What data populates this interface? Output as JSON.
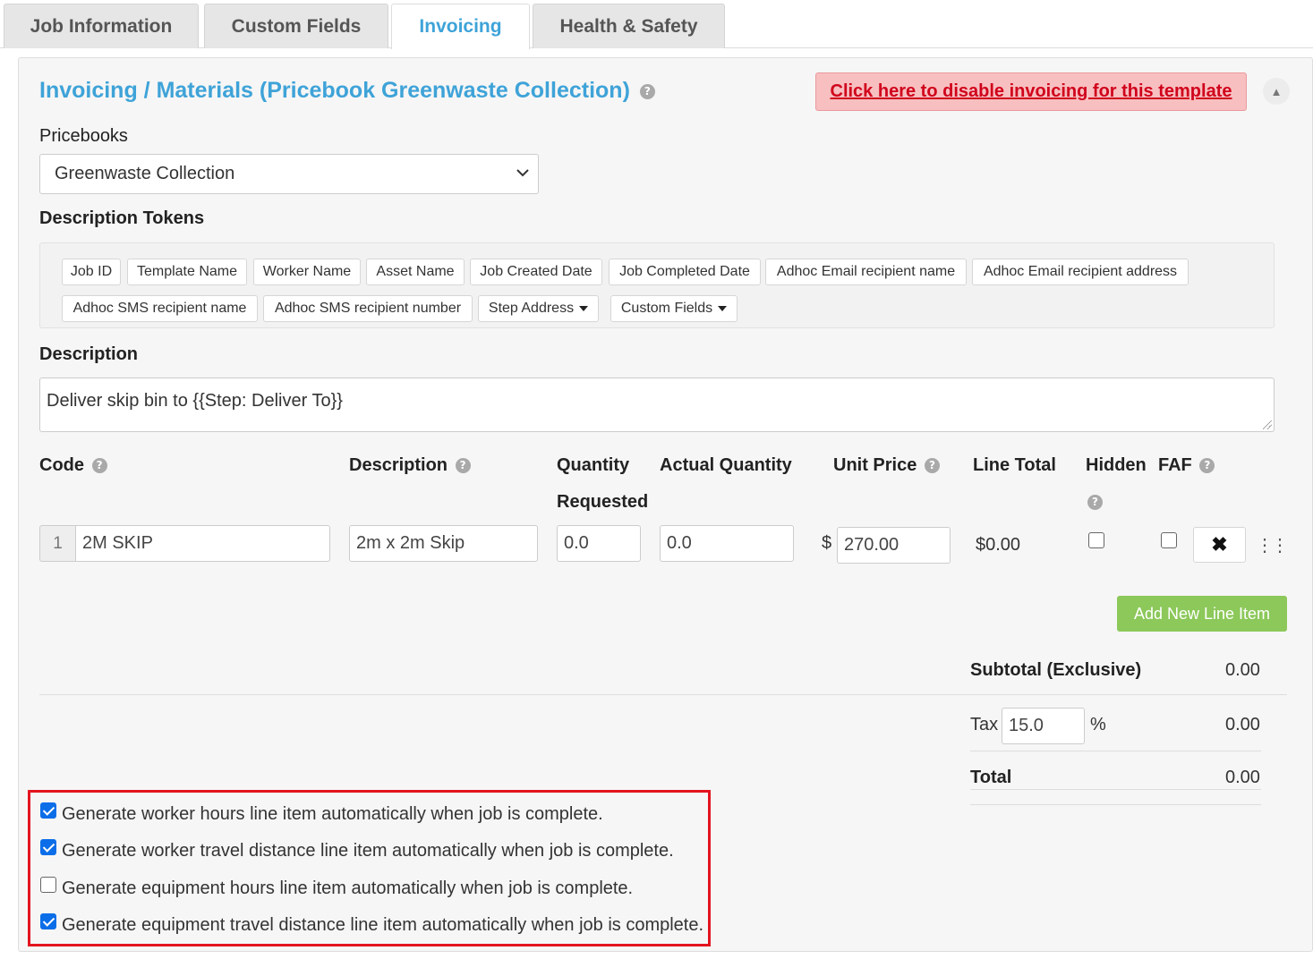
{
  "tabs": [
    {
      "label": "Job Information",
      "active": false
    },
    {
      "label": "Custom Fields",
      "active": false
    },
    {
      "label": "Invoicing",
      "active": true
    },
    {
      "label": "Health & Safety",
      "active": false
    }
  ],
  "panel": {
    "title": "Invoicing / Materials (Pricebook Greenwaste Collection)",
    "help_icon": "question-circle-icon",
    "disable_button": "Click here to disable invoicing for this template",
    "collapse_icon": "caret-up-icon"
  },
  "pricebooks": {
    "label": "Pricebooks",
    "selected": "Greenwaste Collection"
  },
  "tokens": {
    "label": "Description Tokens",
    "items": [
      "Job ID",
      "Template Name",
      "Worker Name",
      "Asset Name",
      "Job Created Date",
      "Job Completed Date",
      "Adhoc Email recipient name",
      "Adhoc Email recipient address",
      "Adhoc SMS recipient name",
      "Adhoc SMS recipient number"
    ],
    "dropdowns": [
      "Step Address",
      "Custom Fields"
    ]
  },
  "description": {
    "label": "Description",
    "value": "Deliver skip bin to {{Step: Deliver To}}"
  },
  "table": {
    "headers": {
      "code": "Code",
      "description": "Description",
      "quantity_line1": "Quantity",
      "quantity_line2": "Requested",
      "actual_quantity": "Actual Quantity",
      "unit_price": "Unit Price",
      "line_total": "Line Total",
      "hidden": "Hidden",
      "faf": "FAF"
    },
    "rows": [
      {
        "num": "1",
        "code": "2M SKIP",
        "description": "2m x 2m Skip",
        "quantity": "0.0",
        "actual_quantity": "0.0",
        "currency": "$",
        "unit_price": "270.00",
        "line_total": "$0.00",
        "hidden": false,
        "faf": false
      }
    ],
    "add_button": "Add New Line Item"
  },
  "totals": {
    "subtotal_label": "Subtotal (Exclusive)",
    "subtotal_value": "0.00",
    "tax_label": "Tax",
    "tax_rate": "15.0",
    "tax_unit": "%",
    "tax_value": "0.00",
    "total_label": "Total",
    "total_value": "0.00"
  },
  "auto_generate": [
    {
      "label": "Generate worker hours line item automatically when job is complete.",
      "checked": true
    },
    {
      "label": "Generate worker travel distance line item automatically when job is complete.",
      "checked": true
    },
    {
      "label": "Generate equipment hours line item automatically when job is complete.",
      "checked": false
    },
    {
      "label": "Generate equipment travel distance line item automatically when job is complete.",
      "checked": true
    }
  ],
  "colors": {
    "accent": "#3ea3d8",
    "danger_text": "#d0021b",
    "danger_bg": "#f7bfc0",
    "success": "#8cc85a",
    "highlight_border": "#e3141f",
    "checkbox_checked": "#0b6ee8"
  }
}
